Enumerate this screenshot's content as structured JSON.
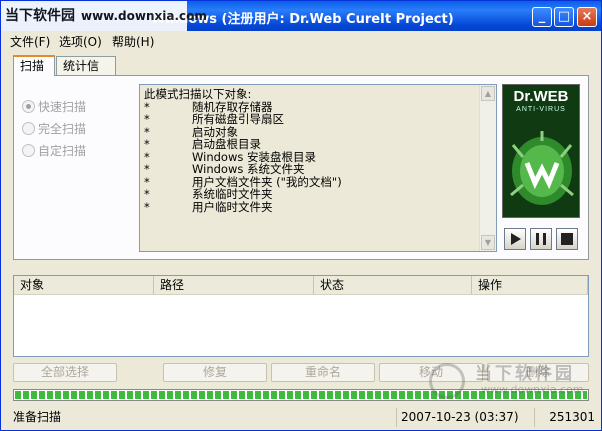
{
  "window": {
    "title": "Windows (注册用户: Dr.Web CureIt Project)",
    "minimize_glyph": "_",
    "maximize_glyph": "□",
    "close_glyph": "×"
  },
  "watermark_top": {
    "logo": "当下软件园",
    "url": "www.downxia.com"
  },
  "menu": [
    "文件(F)",
    "选项(O)",
    "帮助(H)"
  ],
  "tabs": [
    "扫描",
    "统计信息"
  ],
  "scan_modes": [
    {
      "label": "快速扫描",
      "selected": true
    },
    {
      "label": "完全扫描",
      "selected": false
    },
    {
      "label": "自定扫描",
      "selected": false
    }
  ],
  "info": {
    "header": "此模式扫描以下对象:",
    "bullet": "*",
    "items": [
      "随机存取存储器",
      "所有磁盘引导扇区",
      "启动对象",
      "启动盘根目录",
      "Windows 安装盘根目录",
      "Windows 系统文件夹",
      "用户文档文件夹 (\"我的文档\")",
      "系统临时文件夹",
      "用户临时文件夹"
    ]
  },
  "logo": {
    "brand": "Dr.WEB",
    "sub": "ANTI-VIRUS"
  },
  "list_columns": [
    "对象",
    "路径",
    "状态",
    "操作"
  ],
  "buttons": {
    "select_all": "全部选择",
    "repair": "修复",
    "rename": "重命名",
    "move": "移动",
    "delete": "删除"
  },
  "progress_percent": 100,
  "status": {
    "text": "准备扫描",
    "date": "2007-10-23 (03:37)",
    "count": "251301"
  },
  "watermark_br": {
    "name": "当下软件园",
    "url": "www.downxia.com"
  },
  "colors": {
    "titlebar": "#0548d6",
    "progress": "#3cbc3c",
    "tab_accent": "#e68b2c"
  }
}
